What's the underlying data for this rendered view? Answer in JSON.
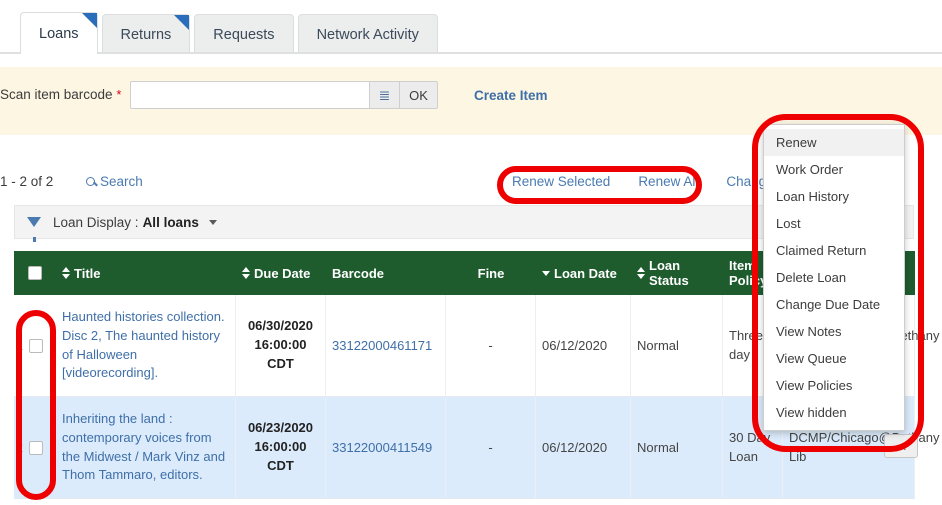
{
  "tabs": [
    {
      "label": "Loans",
      "active": true,
      "flag": true
    },
    {
      "label": "Returns",
      "active": false,
      "flag": true
    },
    {
      "label": "Requests",
      "active": false,
      "flag": false
    },
    {
      "label": "Network Activity",
      "active": false,
      "flag": false
    }
  ],
  "scanbar": {
    "label": "Scan item barcode",
    "required_marker": "*",
    "input_value": "",
    "input_placeholder": "",
    "list_icon": "list-icon",
    "ok_label": "OK",
    "create_item_label": "Create Item"
  },
  "toolbar": {
    "count": "1 - 2 of 2",
    "search_label": "Search",
    "search_icon": "search-icon",
    "actions": [
      "Renew Selected",
      "Renew All",
      "Change"
    ]
  },
  "filter": {
    "icon": "funnel-icon",
    "label": "Loan Display :",
    "value": "All loans",
    "caret": "chevron-down-icon"
  },
  "table": {
    "headers": [
      {
        "label": "",
        "sort": "none",
        "kind": "checkbox"
      },
      {
        "label": "Title",
        "sort": "both"
      },
      {
        "label": "Due Date",
        "sort": "both"
      },
      {
        "label": "Barcode",
        "sort": "none"
      },
      {
        "label": "Fine",
        "sort": "none"
      },
      {
        "label": "Loan Date",
        "sort": "desc"
      },
      {
        "label": "Loan Status",
        "sort": "both"
      },
      {
        "label": "Item Policy",
        "sort": "none"
      }
    ],
    "rows": [
      {
        "no": "1",
        "title": "Haunted histories collection. Disc 2, The haunted history of Halloween [videorecording].",
        "due_date": "06/30/2020 16:00:00 CDT",
        "barcode": "33122000461171",
        "fine": "-",
        "loan_date": "06/12/2020",
        "loan_status": "Normal",
        "item_policy": "Three day",
        "location": "DCMP/Chicago@Bethany Lib",
        "selected": false
      },
      {
        "no": "2",
        "title": "Inheriting the land : contemporary voices from the Midwest / Mark Vinz and Thom Tammaro, editors.",
        "due_date": "06/23/2020 16:00:00 CDT",
        "barcode": "33122000411549",
        "fine": "-",
        "loan_date": "06/12/2020",
        "loan_status": "Normal",
        "item_policy": "30 Day Loan",
        "location": "DCMP/Chicago@Bethany Lib",
        "selected": true
      }
    ],
    "row_menu_button": "..."
  },
  "context_menu": {
    "items": [
      {
        "label": "Renew",
        "highlighted": true
      },
      {
        "label": "Work Order",
        "highlighted": false
      },
      {
        "label": "Loan History",
        "highlighted": false
      },
      {
        "label": "Lost",
        "highlighted": false
      },
      {
        "label": "Claimed Return",
        "highlighted": false
      },
      {
        "label": "Delete Loan",
        "highlighted": false
      },
      {
        "label": "Change Due Date",
        "highlighted": false
      },
      {
        "label": "View Notes",
        "highlighted": false
      },
      {
        "label": "View Queue",
        "highlighted": false
      },
      {
        "label": "View Policies",
        "highlighted": false
      },
      {
        "label": "View hidden",
        "highlighted": false
      }
    ]
  },
  "annotations": {
    "color": "#ee0000",
    "shapes": [
      "renew-actions-highlight",
      "context-menu-highlight",
      "row-checkbox-highlight"
    ]
  },
  "colors": {
    "table_header_green": "#1e5c2e",
    "link_blue": "#3f6fa8",
    "scan_band_cream": "#fdf6e3",
    "selected_row_blue": "#dbebfb",
    "tab_flag_blue": "#2a6ebb",
    "annotation_red": "#ee0000"
  }
}
